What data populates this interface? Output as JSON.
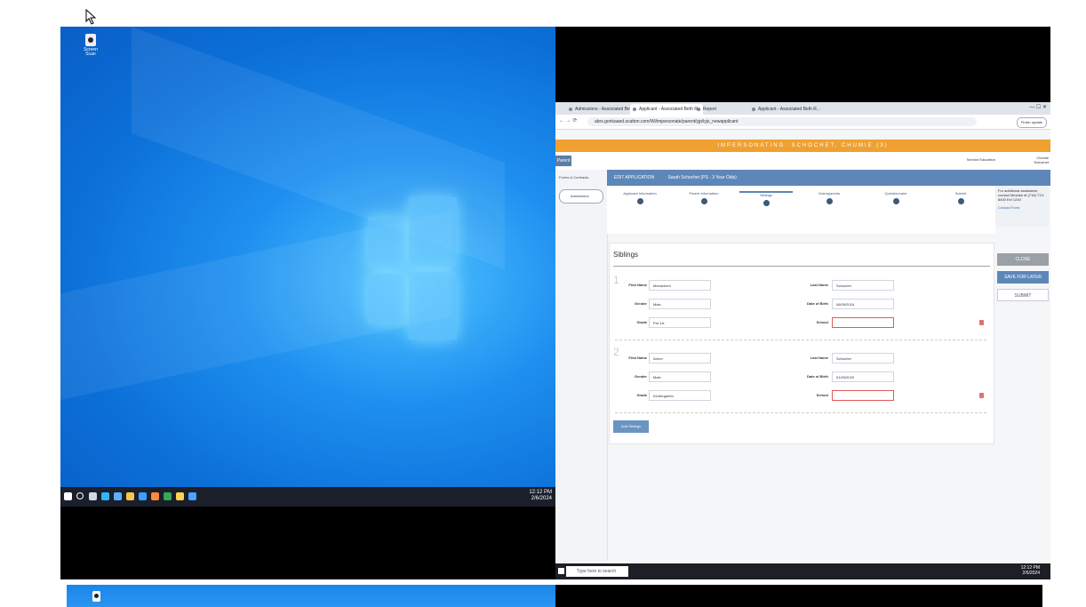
{
  "desktop": {
    "icon_label": "Screen Scan",
    "clock": "12:12 PM",
    "date": "2/6/2024",
    "taskbar_icons": [
      {
        "name": "windows-start",
        "color": "#ffffff"
      },
      {
        "name": "search",
        "color": "#ffffff"
      },
      {
        "name": "task-view",
        "color": "#ffffff"
      },
      {
        "name": "edge",
        "color": "#2fb7f5"
      },
      {
        "name": "store",
        "color": "#5ab0ff"
      },
      {
        "name": "folder",
        "color": "#f2c94c"
      },
      {
        "name": "mail",
        "color": "#3aa0ff"
      },
      {
        "name": "app-triangle",
        "color": "#ff8a3d"
      },
      {
        "name": "chrome",
        "color": "#34a853"
      },
      {
        "name": "sticky-notes",
        "color": "#ffd54f"
      },
      {
        "name": "app-blue",
        "color": "#4aa3ff"
      }
    ]
  },
  "browser": {
    "tabs": [
      "Admissions - Associated Beth R...",
      "Applicant - Associated Beth R...",
      "Report",
      "Applicant - Associated Beth R..."
    ],
    "url": "abrs.gonkaaed.scatton.com/Wi/impersonate/parent/yjp/iyjs_newapplicant",
    "reauth": "Finish update",
    "impersonating": "IMPERSONATING: SCHOCHET, CHUMIE (3)",
    "parent_label": "Parent",
    "service_label": "Service Education",
    "user_name": "Chumie Schochet",
    "forms_label": "Forms & Contracts",
    "admissions_label": "Admissions",
    "header_edit": "EDIT APPLICATION",
    "header_student": "Sarah Schochet (PS - 3 Year Olds)",
    "steps": [
      "Applicant Information",
      "Parent Information",
      "Siblings",
      "Grandparents",
      "Questionnaire",
      "Submit"
    ],
    "help_text": "For additional assistance, contact Meshke at (718) 713-8400 Ext 1240",
    "contact_label": "Contact Form",
    "form_title": "Siblings",
    "labels": {
      "first_name": "First Name",
      "last_name": "Last Name",
      "gender": "Gender",
      "dob": "Date of Birth",
      "grade": "Grade",
      "school": "School"
    },
    "siblings": [
      {
        "num": "1",
        "first": "Menachem",
        "last": "Schochet",
        "gender": "Male",
        "dob": "06/09/2018",
        "grade": "Pre-1A",
        "school": ""
      },
      {
        "num": "2",
        "first": "Ahron",
        "last": "Schochet",
        "gender": "Male",
        "dob": "01/09/2020",
        "grade": "Kindergarten",
        "school": ""
      }
    ],
    "add_sibling": "Add Siblings",
    "close_btn": "CLOSE",
    "save_btn": "SAVE FOR LATER",
    "submit_btn": "SUBMIT",
    "taskbar_search": "Type here to search",
    "clock": "12:12 PM",
    "date": "2/6/2024"
  }
}
